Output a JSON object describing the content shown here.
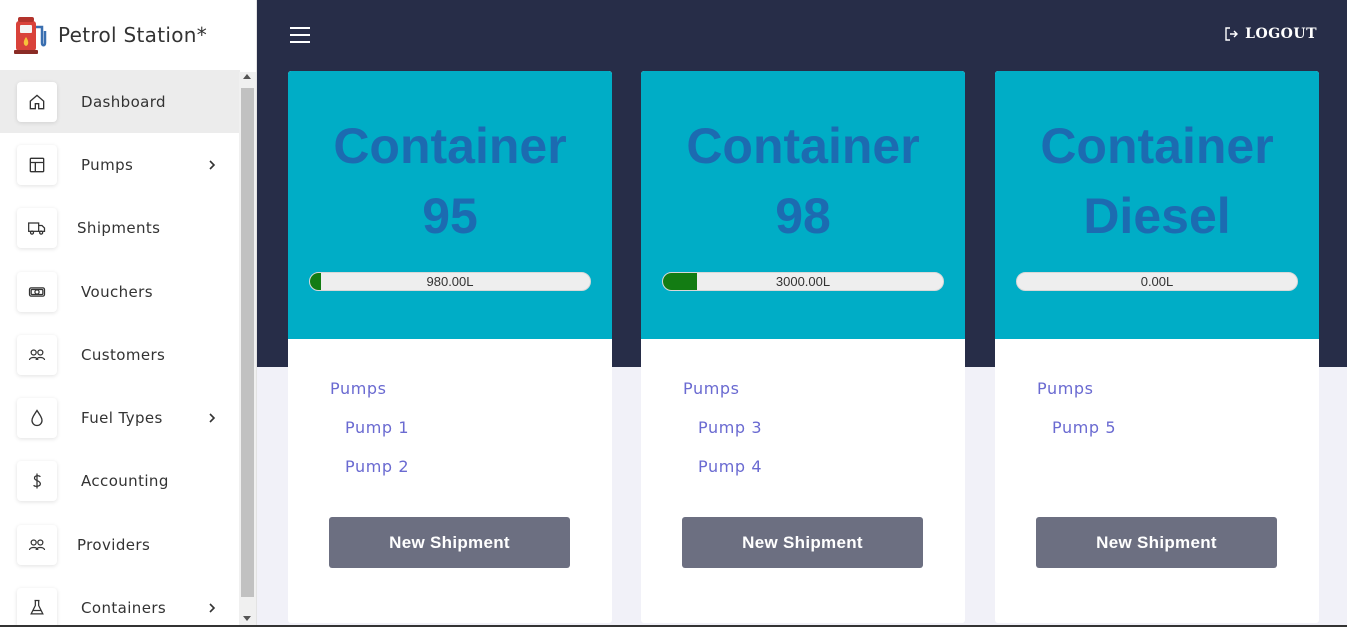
{
  "app": {
    "title": "Petrol Station*"
  },
  "sidebar": {
    "items": [
      {
        "label": "Dashboard",
        "icon": "home-icon",
        "active": true,
        "has_submenu": false
      },
      {
        "label": "Pumps",
        "icon": "layout-icon",
        "active": false,
        "has_submenu": true
      },
      {
        "label": "Shipments",
        "icon": "truck-icon",
        "active": false,
        "has_submenu": false
      },
      {
        "label": "Vouchers",
        "icon": "money-icon",
        "active": false,
        "has_submenu": false
      },
      {
        "label": "Customers",
        "icon": "users-icon",
        "active": false,
        "has_submenu": false
      },
      {
        "label": "Fuel Types",
        "icon": "droplet-icon",
        "active": false,
        "has_submenu": true
      },
      {
        "label": "Accounting",
        "icon": "dollar-icon",
        "active": false,
        "has_submenu": false
      },
      {
        "label": "Providers",
        "icon": "users-icon",
        "active": false,
        "has_submenu": false
      },
      {
        "label": "Containers",
        "icon": "flask-icon",
        "active": false,
        "has_submenu": true
      }
    ]
  },
  "header": {
    "logout_label": "LOGOUT"
  },
  "cards": [
    {
      "title_line1": "Container",
      "title_line2": "95",
      "level_text": "980.00L",
      "level_fraction": 0.04,
      "pumps_title": "Pumps",
      "pumps": [
        "Pump 1",
        "Pump 2"
      ],
      "button_label": "New Shipment"
    },
    {
      "title_line1": "Container",
      "title_line2": "98",
      "level_text": "3000.00L",
      "level_fraction": 0.12,
      "pumps_title": "Pumps",
      "pumps": [
        "Pump 3",
        "Pump 4"
      ],
      "button_label": "New Shipment"
    },
    {
      "title_line1": "Container",
      "title_line2": "Diesel",
      "level_text": "0.00L",
      "level_fraction": 0.0,
      "pumps_title": "Pumps",
      "pumps": [
        "Pump 5"
      ],
      "button_label": "New Shipment"
    }
  ],
  "colors": {
    "header_bg": "#272d48",
    "card_top": "#00adc6",
    "title_color": "#1c6bb1",
    "level_fill": "#137c13",
    "link_color": "#6a6ad1",
    "button_bg": "#6c6f81"
  }
}
